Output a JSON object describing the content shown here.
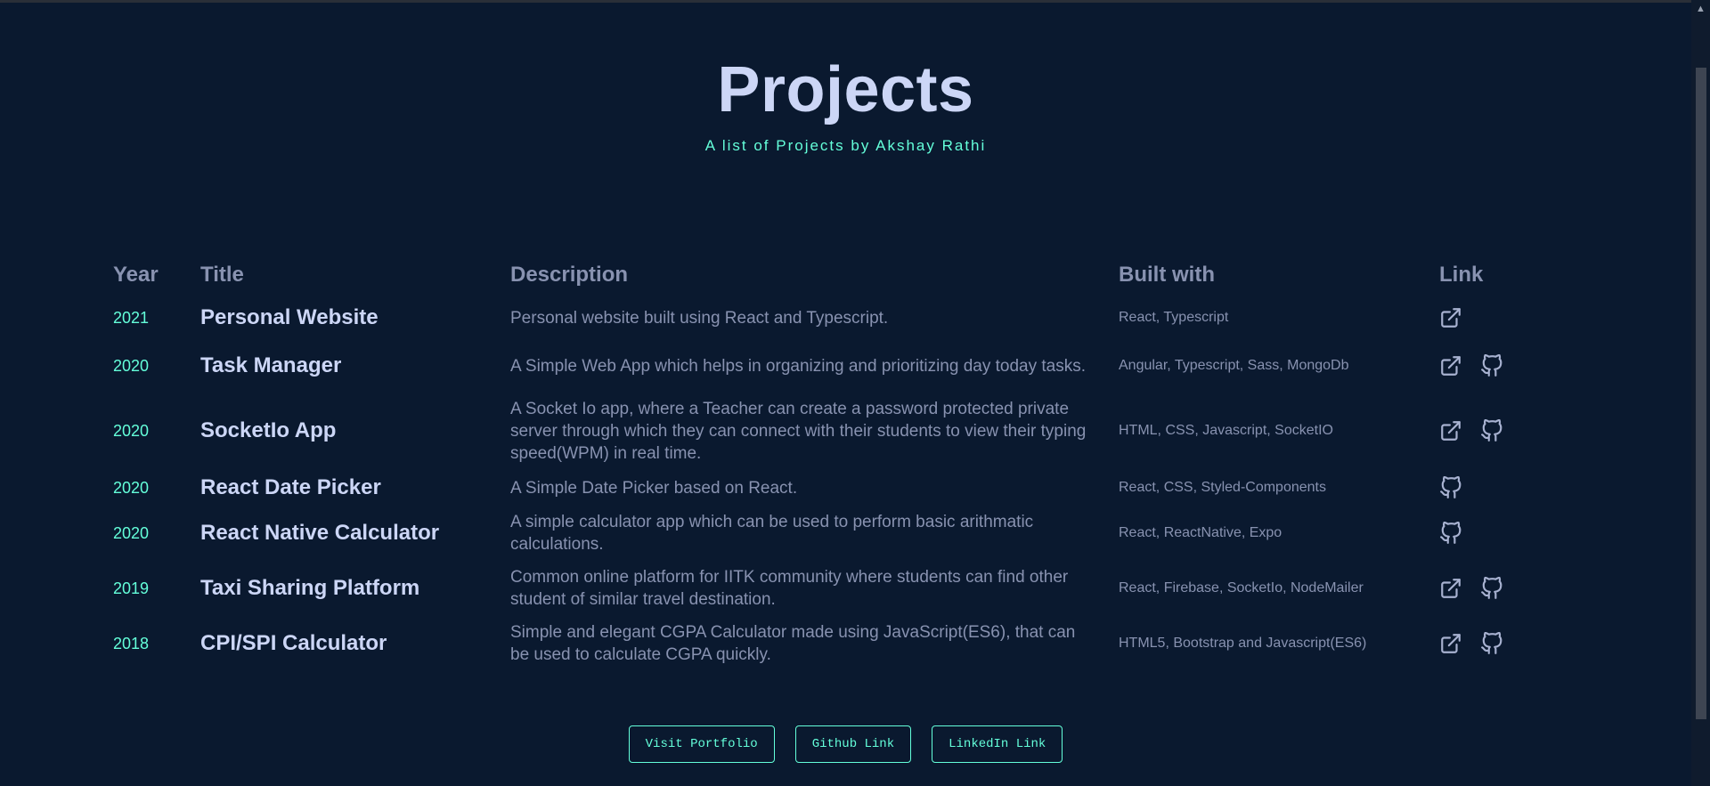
{
  "header": {
    "title": "Projects",
    "subtitle": "A list of Projects by Akshay Rathi"
  },
  "table": {
    "columns": [
      "Year",
      "Title",
      "Description",
      "Built with",
      "Link"
    ],
    "rows": [
      {
        "year": "2021",
        "title": "Personal Website",
        "description": "Personal website built using React and Typescript.",
        "built_with": "React, Typescript",
        "links": [
          "external-link-icon"
        ]
      },
      {
        "year": "2020",
        "title": "Task Manager",
        "description": "A Simple Web App which helps in organizing and prioritizing day today tasks.",
        "built_with": "Angular, Typescript, Sass, MongoDb",
        "links": [
          "external-link-icon",
          "github-icon"
        ]
      },
      {
        "year": "2020",
        "title": "SocketIo App",
        "description": "A Socket Io app, where a Teacher can create a password protected private server through which they can connect with their students to view their typing speed(WPM) in real time.",
        "built_with": "HTML, CSS, Javascript, SocketIO",
        "links": [
          "external-link-icon",
          "github-icon"
        ]
      },
      {
        "year": "2020",
        "title": "React Date Picker",
        "description": "A Simple Date Picker based on React.",
        "built_with": "React, CSS, Styled-Components",
        "links": [
          "github-icon"
        ]
      },
      {
        "year": "2020",
        "title": "React Native Calculator",
        "description": "A simple calculator app which can be used to perform basic arithmatic calculations.",
        "built_with": "React, ReactNative, Expo",
        "links": [
          "github-icon"
        ]
      },
      {
        "year": "2019",
        "title": "Taxi Sharing Platform",
        "description": "Common online platform for IITK community where students can find other student of similar travel destination.",
        "built_with": "React, Firebase, SocketIo, NodeMailer",
        "links": [
          "external-link-icon",
          "github-icon"
        ]
      },
      {
        "year": "2018",
        "title": "CPI/SPI Calculator",
        "description": "Simple and elegant CGPA Calculator made using JavaScript(ES6), that can be used to calculate CGPA quickly.",
        "built_with": "HTML5, Bootstrap and Javascript(ES6)",
        "links": [
          "external-link-icon",
          "github-icon"
        ]
      }
    ]
  },
  "footer": {
    "buttons": [
      "Visit Portfolio",
      "Github Link",
      "LinkedIn Link"
    ]
  },
  "colors": {
    "background": "#0a192f",
    "accent": "#64ffda",
    "heading": "#ccd6f6",
    "text": "#8892b0"
  }
}
